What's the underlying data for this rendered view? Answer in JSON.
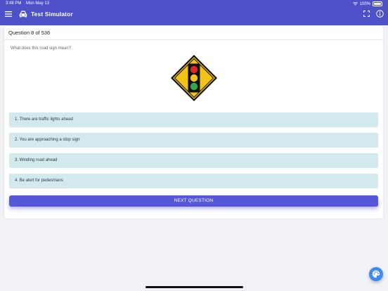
{
  "status_bar": {
    "time": "3:48 PM",
    "date": "Mon May 13",
    "battery": "100%"
  },
  "header": {
    "title": "Test Simulator",
    "background": "#4f51c8"
  },
  "question": {
    "counter": "Question 8 of 536",
    "text": "What does this road sign mean?",
    "image": "traffic-lights-ahead-sign"
  },
  "answers": [
    "1. There are traffic lights ahead",
    "2. You are approaching a stop sign",
    "3. Winding road ahead",
    "4. Be alert for pedestrians"
  ],
  "next_button": "NEXT QUESTION",
  "colors": {
    "answer_bg": "#d2eaee",
    "button": "#5556d8",
    "fab": "#3d8bf2"
  }
}
